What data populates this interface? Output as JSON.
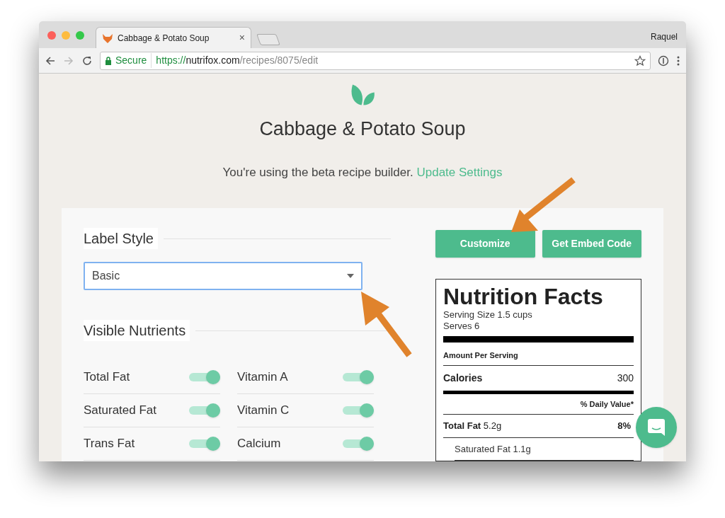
{
  "browser": {
    "tab_title": "Cabbage & Potato Soup",
    "tab_close": "×",
    "profile": "Raquel",
    "secure_label": "Secure",
    "url_scheme": "https://",
    "url_host": "nutrifox.com",
    "url_path": "/recipes/8075/edit"
  },
  "page": {
    "title": "Cabbage & Potato Soup",
    "notice": "You're using the beta recipe builder.",
    "notice_link": "Update Settings"
  },
  "label_style": {
    "heading": "Label Style",
    "value": "Basic"
  },
  "visible_nutrients": {
    "heading": "Visible Nutrients",
    "items": [
      {
        "name": "Total Fat",
        "on": true
      },
      {
        "name": "Vitamin A",
        "on": true
      },
      {
        "name": "Saturated Fat",
        "on": true
      },
      {
        "name": "Vitamin C",
        "on": true
      },
      {
        "name": "Trans Fat",
        "on": true
      },
      {
        "name": "Calcium",
        "on": true
      }
    ]
  },
  "buttons": [
    "Customize",
    "Get Embed Code"
  ],
  "nutrition_label": {
    "title": "Nutrition Facts",
    "serving_size": "Serving Size 1.5 cups",
    "serves": "Serves 6",
    "amount_per_serving": "Amount Per Serving",
    "calories_label": "Calories",
    "calories_value": "300",
    "daily_value_header": "% Daily Value*",
    "rows": [
      {
        "name": "Total Fat",
        "amount": "5.2g",
        "percent": "8%",
        "indent": false
      },
      {
        "name": "Saturated Fat",
        "amount": "1.1g",
        "indent": true
      }
    ]
  }
}
